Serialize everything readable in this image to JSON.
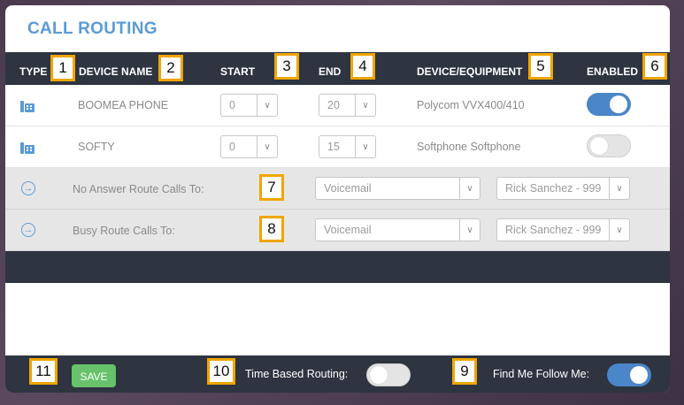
{
  "title": "CALL ROUTING",
  "columns": {
    "type": "TYPE",
    "device_name": "DEVICE NAME",
    "start": "START",
    "end": "END",
    "equipment": "DEVICE/EQUIPMENT",
    "enabled": "ENABLED"
  },
  "devices": [
    {
      "name": "BOOMEA PHONE",
      "start": "0",
      "end": "20",
      "equipment": "Polycom VVX400/410",
      "enabled": true
    },
    {
      "name": "SOFTY",
      "start": "0",
      "end": "15",
      "equipment": "Softphone Softphone",
      "enabled": false
    }
  ],
  "routes": [
    {
      "label": "No Answer Route Calls To:",
      "target": "Voicemail",
      "user": "Rick Sanchez - 999"
    },
    {
      "label": "Busy Route Calls To:",
      "target": "Voicemail",
      "user": "Rick Sanchez - 999"
    }
  ],
  "footer": {
    "save_label": "SAVE",
    "time_based_label": "Time Based Routing:",
    "time_based_enabled": false,
    "find_me_label": "Find Me Follow Me:",
    "find_me_enabled": true
  },
  "annotations": [
    "1",
    "2",
    "3",
    "4",
    "5",
    "6",
    "7",
    "8",
    "9",
    "10",
    "11"
  ],
  "colors": {
    "accent": "#5b9bd5",
    "dark": "#2e3440",
    "save": "#67c26b",
    "toggle_on": "#4a86c8",
    "badge_border": "#f0a500"
  }
}
